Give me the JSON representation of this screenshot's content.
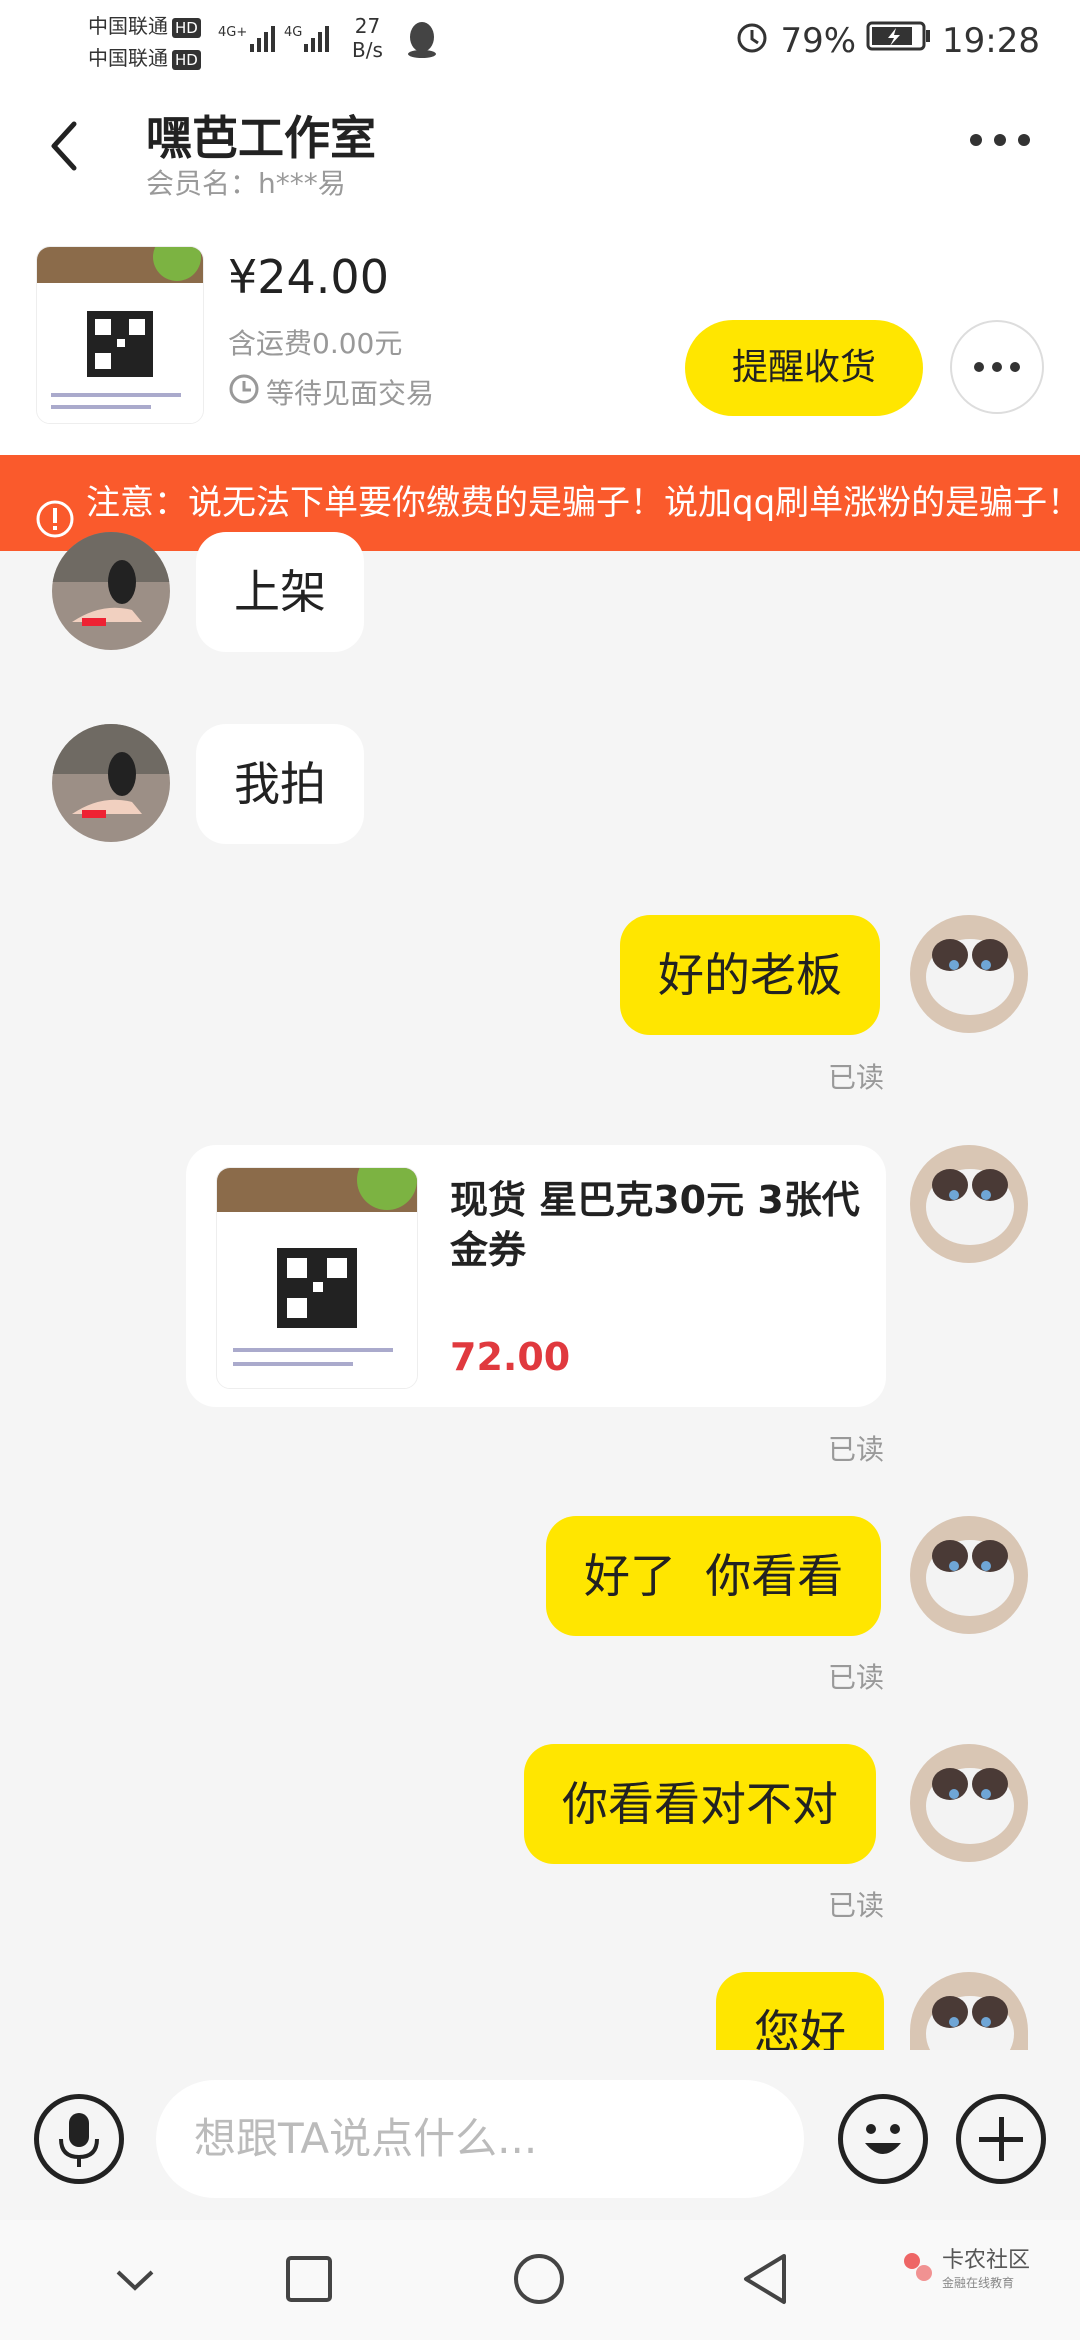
{
  "status_bar": {
    "carrier1": "中国联通",
    "carrier2": "中国联通",
    "hd": "HD",
    "net1": "4G+",
    "net2": "4G",
    "speed_value": "27",
    "speed_unit": "B/s",
    "battery": "79%",
    "time": "19:28"
  },
  "header": {
    "title": "嘿芭工作室",
    "subtitle": "会员名：h***易"
  },
  "order": {
    "price": "¥24.00",
    "shipping": "含运费0.00元",
    "status": "等待见面交易",
    "remind_button": "提醒收货"
  },
  "notice": {
    "text": "注意：说无法下单要你缴费的是骗子！说加qq刷单涨粉的是骗子！"
  },
  "messages": {
    "m1": "上架",
    "m2": "我拍",
    "m3": "好的老板",
    "m4_title": "现货 星巴克30元 3张代金券",
    "m4_price": "72.00",
    "m5": "好了  你看看",
    "m6": "你看看对不对",
    "m7": "您好",
    "read": "已读"
  },
  "input": {
    "placeholder": "想跟TA说点什么..."
  },
  "watermark": {
    "text": "卡农社区",
    "sub": "金融在线教育"
  },
  "colors": {
    "accent": "#ffe600",
    "notice_bg": "#fa5a2c",
    "price_red": "#e0393e"
  }
}
